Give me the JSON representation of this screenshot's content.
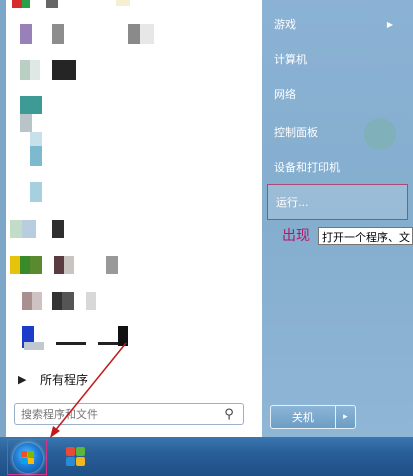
{
  "right_pane": {
    "items": [
      {
        "label": "游戏",
        "has_submenu": true
      },
      {
        "label": "计算机"
      },
      {
        "label": "网络"
      },
      {
        "label": "控制面板"
      },
      {
        "label": "设备和打印机"
      }
    ],
    "run_label": "运行...",
    "shutdown_label": "关机",
    "shutdown_options_glyph": "▸"
  },
  "left_pane": {
    "all_programs_label": "所有程序",
    "search_placeholder": "搜索程序和文件"
  },
  "tooltip": {
    "text": "打开一个程序、文"
  },
  "annotation": {
    "text": "出现"
  },
  "colors": {
    "annotation": "#b2176a",
    "highlight_border": "#a94a7a"
  },
  "icons": {
    "search": "magnifier-icon",
    "start": "windows-orb-icon"
  }
}
